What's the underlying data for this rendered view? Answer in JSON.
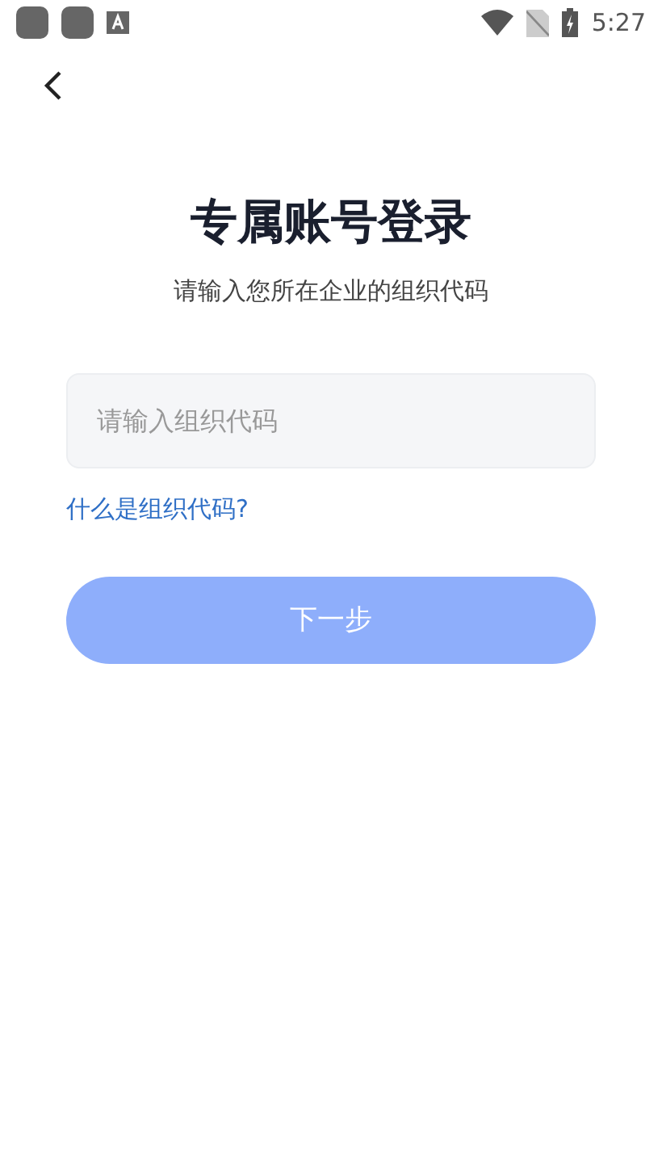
{
  "status_bar": {
    "time": "5:27"
  },
  "title": "专属账号登录",
  "subtitle": "请输入您所在企业的组织代码",
  "org_code_field": {
    "placeholder": "请输入组织代码"
  },
  "help_link": "什么是组织代码?",
  "next_button": {
    "label": "下一步",
    "disabled": true
  }
}
